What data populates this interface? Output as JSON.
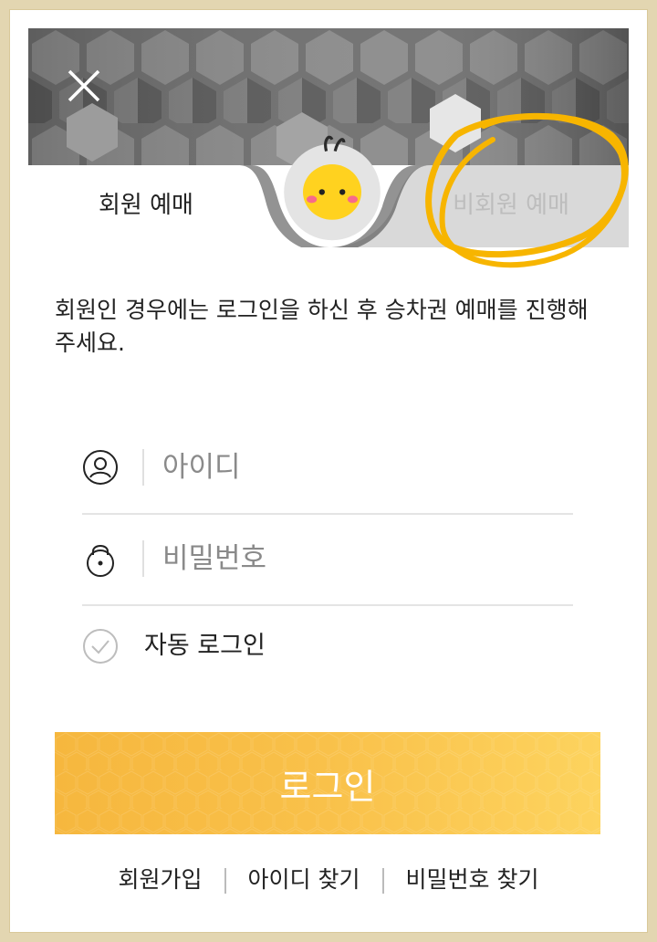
{
  "tabs": {
    "member_label": "회원 예매",
    "guest_label": "비회원 예매"
  },
  "icons": {
    "close": "close-icon",
    "mascot": "mascot-icon",
    "user": "user-icon",
    "lock": "lock-icon",
    "check": "check-icon"
  },
  "description": "회원인 경우에는 로그인을 하신 후 승차권 예매를 진행해 주세요.",
  "form": {
    "id_placeholder": "아이디",
    "password_placeholder": "비밀번호",
    "auto_login_label": "자동 로그인"
  },
  "login_button_label": "로그인",
  "footer": {
    "signup": "회원가입",
    "find_id": "아이디 찾기",
    "find_password": "비밀번호 찾기"
  },
  "colors": {
    "accent": "#f9c14a",
    "highlight_scribble": "#f7b500",
    "inactive_tab": "#d9d9d9"
  }
}
